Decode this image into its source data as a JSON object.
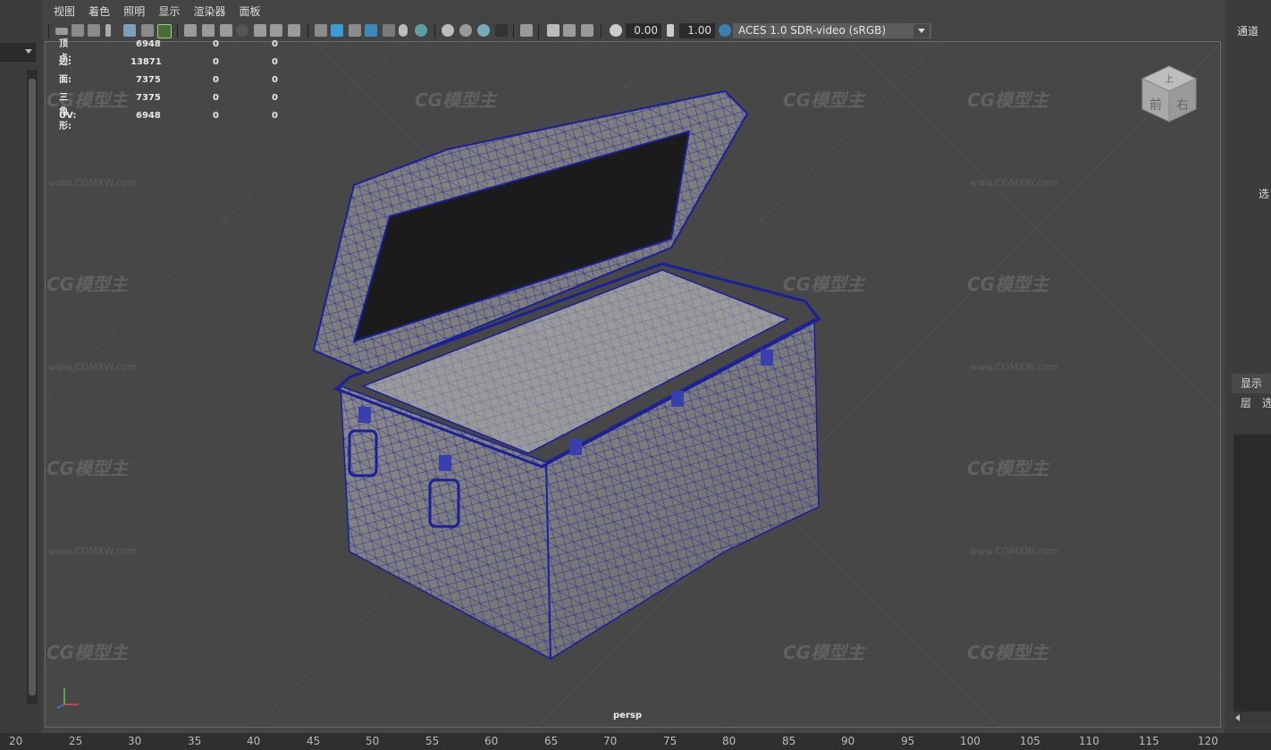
{
  "panel_menu": [
    "视图",
    "着色",
    "照明",
    "显示",
    "渲染器",
    "面板"
  ],
  "toolbar": {
    "exposure_value": "0.00",
    "gamma_value": "1.00",
    "color_management": "ACES 1.0 SDR-video (sRGB)"
  },
  "hud": {
    "rows": [
      {
        "label": "顶点:",
        "v1": "6948",
        "v2": "0",
        "v3": "0"
      },
      {
        "label": "边:",
        "v1": "13871",
        "v2": "0",
        "v3": "0"
      },
      {
        "label": "面:",
        "v1": "7375",
        "v2": "0",
        "v3": "0"
      },
      {
        "label": "三角形:",
        "v1": "7375",
        "v2": "0",
        "v3": "0"
      },
      {
        "label": "UV:",
        "v1": "6948",
        "v2": "0",
        "v3": "0"
      }
    ]
  },
  "camera_label": "persp",
  "viewcube": {
    "front": "前",
    "right": "右",
    "top": "上"
  },
  "right_panel": {
    "channels_label": "通道",
    "select_label": "选",
    "display_tab": "显示",
    "layer_label": "层",
    "option_label": "选"
  },
  "watermark": {
    "logo": "CG模型主",
    "url": "www.CGMXW.com"
  },
  "timeline_ticks": [
    "20",
    "25",
    "30",
    "35",
    "40",
    "45",
    "50",
    "55",
    "60",
    "65",
    "70",
    "75",
    "80",
    "85",
    "90",
    "95",
    "100",
    "105",
    "110",
    "115",
    "120"
  ],
  "colors": {
    "wireframe": "#1a1f9a",
    "viewport_bg": "#474747",
    "accent_icon": "#3c9bd6"
  }
}
